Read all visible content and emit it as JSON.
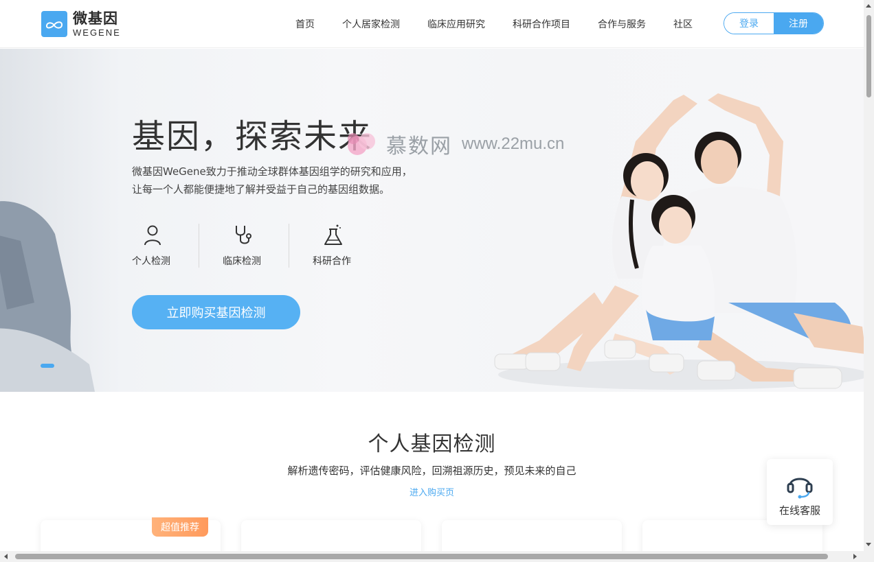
{
  "header": {
    "logo_cn": "微基因",
    "logo_en": "WEGENE",
    "nav": [
      "首页",
      "个人居家检测",
      "临床应用研究",
      "科研合作项目",
      "合作与服务",
      "社区"
    ],
    "login": "登录",
    "register": "注册"
  },
  "hero": {
    "title": "基因，探索未来",
    "desc_line1": "微基因WeGene致力于推动全球群体基因组学的研究和应用，",
    "desc_line2": "让每一个人都能便捷地了解并受益于自己的基因组数据。",
    "features": [
      {
        "label": "个人检测",
        "icon": "person-icon"
      },
      {
        "label": "临床检测",
        "icon": "stethoscope-icon"
      },
      {
        "label": "科研合作",
        "icon": "flask-icon"
      }
    ],
    "cta": "立即购买基因检测",
    "watermark_cn": "慕数网",
    "watermark_url": "www.22mu.cn"
  },
  "section": {
    "title": "个人基因检测",
    "subtitle": "解析遗传密码，评估健康风险，回溯祖源历史，预见未来的自己",
    "link": "进入购买页",
    "badge": "超值推荐"
  },
  "service": {
    "label": "在线客服",
    "icon": "headset-icon"
  },
  "colors": {
    "accent": "#4aa8f0",
    "cta": "#56b1f3",
    "badge": "#ff9a5c"
  }
}
